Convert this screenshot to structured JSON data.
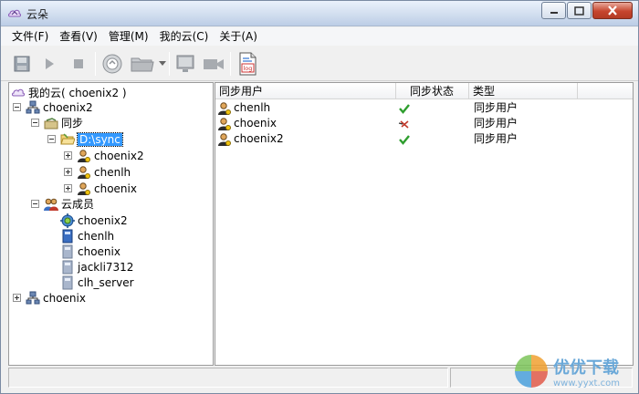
{
  "window": {
    "title": "云朵"
  },
  "menu": [
    "文件(F)",
    "查看(V)",
    "管理(M)",
    "我的云(C)",
    "关于(A)"
  ],
  "toolbar": {
    "save": "save-icon",
    "play": "play-icon",
    "stop": "stop-icon",
    "cloud": "cloud-icon",
    "folder": "folder-icon",
    "monitor": "monitor-icon",
    "camera": "camera-icon",
    "log": "log-icon",
    "log_label": "log"
  },
  "tree": {
    "root": "我的云( choenix2 )",
    "n1": "choenix2",
    "n1_sync": "同步",
    "n1_sync_dir": "D:\\sync",
    "n1_sync_u1": "choenix2",
    "n1_sync_u2": "chenlh",
    "n1_sync_u3": "choenix",
    "n1_members": "云成员",
    "m1": "choenix2",
    "m2": "chenlh",
    "m3": "choenix",
    "m4": "jackli7312",
    "m5": "clh_server",
    "n2": "choenix"
  },
  "list": {
    "columns": [
      "同步用户",
      "同步状态",
      "类型"
    ],
    "rows": [
      {
        "user": "chenlh",
        "status": "ok",
        "type": "同步用户"
      },
      {
        "user": "choenix",
        "status": "error",
        "type": "同步用户"
      },
      {
        "user": "choenix2",
        "status": "ok",
        "type": "同步用户"
      }
    ]
  },
  "watermark": {
    "text": "优优下载",
    "url": "www.yyxt.com"
  },
  "colors": {
    "ok": "#2e9e2e",
    "error": "#c0392b",
    "selection": "#3399ff"
  }
}
